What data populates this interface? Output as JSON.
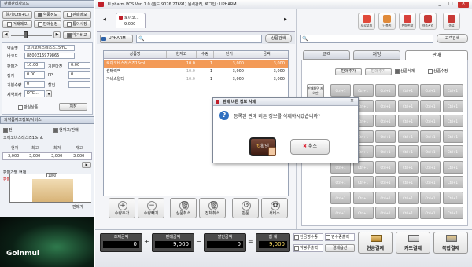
{
  "window": {
    "title": "U pharm POS Ver. 1.0 (빌드 9076.27691) 원격관리, 로그인 : UPHARM"
  },
  "left": {
    "panel1_title": "판매관리자모드",
    "ctrl_buttons": [
      "알기(Ctrl+C)",
      "약품정보",
      "판매메모",
      "거래메모",
      "판매설정",
      "통이사장"
    ],
    "slider_btn": "약가비교",
    "fields": [
      {
        "label": "약품명",
        "value": "코이코비스레스즈15mL"
      },
      {
        "label": "바코드",
        "value": "8800315979865"
      },
      {
        "label": "판매가",
        "value": "10.00",
        "label2": "기본마진",
        "value2": "0.00"
      },
      {
        "label": "정가",
        "value": "0.00",
        "label2": "PP",
        "value2": "0"
      },
      {
        "label": "기본수량",
        "value": "0",
        "label2": "할인",
        "value2": ""
      },
      {
        "label": "제약회사",
        "value": "DTC..."
      }
    ],
    "extra_check": "판심상품",
    "save_btn": "저장",
    "stock_title": "의약품재고정보/서비스",
    "stock_check1": "전",
    "stock_check2": "현재고/판매",
    "stock_drug": "코이코비스레스즈15mL",
    "stock_headers": [
      "현재",
      "최고",
      "최저",
      "재고"
    ],
    "stock_values": [
      "3,000",
      "3,000",
      "3,000",
      "3,000"
    ],
    "chart_title": "판매가별 현재",
    "chart_tag": "판매",
    "chart_value_label": "1000",
    "chart_xlabel": "판매가",
    "brand": "Goinmul"
  },
  "center": {
    "tab_label": "로이코...",
    "tab_sub": "9,000",
    "upharm_btn": "UPHARM",
    "search_btn": "상품검색",
    "table_headers": [
      "상품명",
      "현재고",
      "수량",
      "단가",
      "금액"
    ],
    "rows": [
      {
        "name": "로이코비스레스즈15mL",
        "stock": "10.0",
        "qty": "1",
        "price": "3,000",
        "amount": "3,000"
      },
      {
        "name": "센타럭엑",
        "stock": "10.0",
        "qty": "1",
        "price": "3,000",
        "amount": "3,000"
      },
      {
        "name": "가네스알다",
        "stock": "10.0",
        "qty": "1",
        "price": "3,000",
        "amount": "3,000"
      }
    ],
    "func_buttons": [
      "수량추가",
      "수량빼기",
      "상품취소",
      "전체취소",
      "반품",
      "서비스"
    ]
  },
  "right": {
    "toolbar": [
      "새로고침",
      "단축키",
      "판매현황",
      "약품관리",
      "종료"
    ],
    "customer_btn": "고객검색",
    "tabs": [
      "고객",
      "처방",
      "판매"
    ],
    "sub_tabs": [
      "판매추가",
      "판매추가",
      "상품삭제",
      "상품수정"
    ],
    "side_btn": "판매화면 제외판",
    "tile_label": "Ctrl+1"
  },
  "dialog": {
    "title": "판매 버튼 정보 삭제",
    "message": "등록된 판매 버튼 정보를 삭제하시겠습니까?",
    "ok": "확인",
    "cancel": "취소"
  },
  "bottom": {
    "sum_boxes": [
      {
        "label": "조제금액",
        "value": "0"
      },
      {
        "label": "판매금액",
        "value": "9,000"
      },
      {
        "label": "할인금액",
        "value": "0"
      },
      {
        "label": "합 계",
        "value": "9,000"
      }
    ],
    "checks": [
      "현금영수증",
      "영수증출력",
      "약봉투출력",
      "결제옵션"
    ],
    "pay_buttons": [
      "현금결제",
      "카드결제",
      "복합결제"
    ]
  }
}
